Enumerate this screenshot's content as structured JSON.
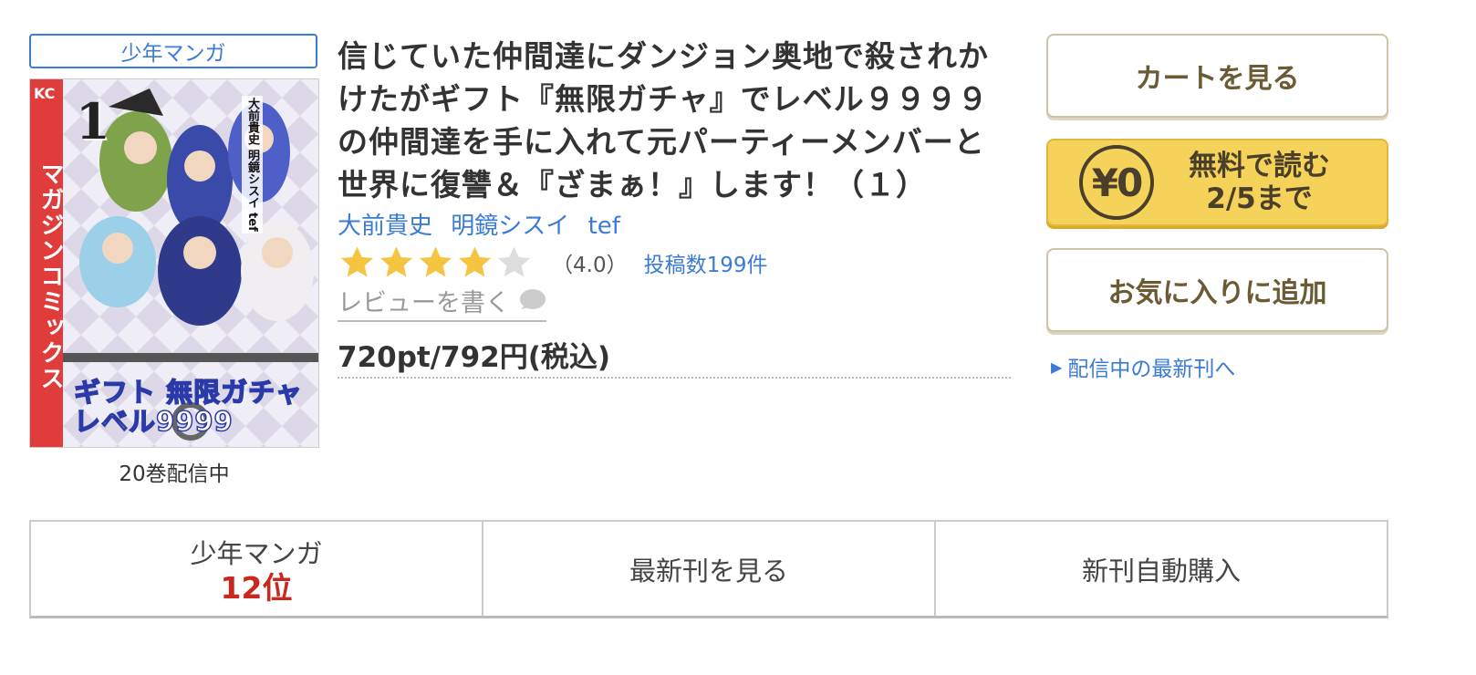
{
  "product": {
    "genre_badge": "少年マンガ",
    "cover": {
      "spine_text": "マガジンコミックス",
      "label": "KC",
      "volume_number": "1",
      "cover_title_line1": "ギフト 無限ガチャ",
      "cover_title_line2": "レベル9999",
      "cover_authors": "大前貴史 明鏡シスイ tef"
    },
    "volumes_available": "20巻配信中",
    "title": "信じていた仲間達にダンジョン奥地で殺されかけたがギフト『無限ガチャ』でレベル９９９９の仲間達を手に入れて元パーティーメンバーと世界に復讐＆『ざまぁ！』します！（１）",
    "authors": [
      "大前貴史",
      "明鏡シスイ",
      "tef"
    ],
    "rating": {
      "stars_filled": 4,
      "stars_total": 5,
      "value_text": "（4.0）",
      "review_count_text": "投稿数199件"
    },
    "write_review": "レビューを書く",
    "price": "720pt/792円(税込)"
  },
  "actions": {
    "cart_button": "カートを見る",
    "free_read": {
      "icon_text": "¥0",
      "line1": "無料で読む",
      "line2": "2/5まで"
    },
    "favorite_button": "お気に入りに追加",
    "latest_link": "配信中の最新刊へ"
  },
  "bottom_bar": {
    "ranking_category": "少年マンガ",
    "ranking_position": "12位",
    "latest_volume": "最新刊を見る",
    "auto_purchase": "新刊自動購入"
  },
  "colors": {
    "link_blue": "#3a7bd5",
    "star_gold": "#f5c542",
    "star_gray": "#dddddd",
    "free_button_yellow": "#f5d25a",
    "rank_red": "#c8281e",
    "button_text_brown": "#6b5a34"
  }
}
